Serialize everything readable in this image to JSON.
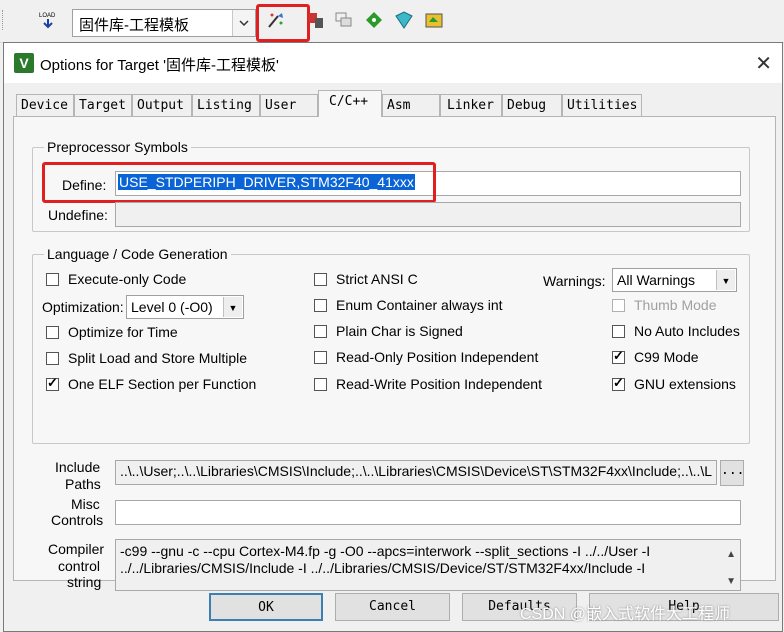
{
  "toolbar": {
    "target_name": "固件库-工程模板",
    "load_label": "LOAD",
    "icons": [
      "load-icon",
      "options-for-target-icon",
      "manage-project-icon",
      "file-extensions-icon",
      "pack-installer-icon",
      "manage-run-time-icon",
      "select-packs-icon"
    ]
  },
  "dialog": {
    "title": "Options for Target '固件库-工程模板'",
    "close": "✕",
    "tabs": [
      "Device",
      "Target",
      "Output",
      "Listing",
      "User",
      "C/C++",
      "Asm",
      "Linker",
      "Debug",
      "Utilities"
    ],
    "active_tab": "C/C++"
  },
  "preprocessor": {
    "group_title": "Preprocessor Symbols",
    "define_label": "Define:",
    "define_value": "USE_STDPERIPH_DRIVER,STM32F40_41xxx",
    "undefine_label": "Undefine:",
    "undefine_value": ""
  },
  "language": {
    "group_title": "Language / Code Generation",
    "execute_only": {
      "label": "Execute-only Code",
      "checked": false
    },
    "optimization_label": "Optimization:",
    "optimization_value": "Level 0 (-O0)",
    "optimize_time": {
      "label": "Optimize for Time",
      "checked": false
    },
    "split_load": {
      "label": "Split Load and Store Multiple",
      "checked": false
    },
    "one_elf": {
      "label": "One ELF Section per Function",
      "checked": true
    },
    "strict_ansi": {
      "label": "Strict ANSI C",
      "checked": false
    },
    "enum_container": {
      "label": "Enum Container always int",
      "checked": false
    },
    "plain_char": {
      "label": "Plain Char is Signed",
      "checked": false
    },
    "ro_pi": {
      "label": "Read-Only Position Independent",
      "checked": false
    },
    "rw_pi": {
      "label": "Read-Write Position Independent",
      "checked": false
    },
    "warnings_label": "Warnings:",
    "warnings_value": "All Warnings",
    "thumb_mode": {
      "label": "Thumb Mode",
      "checked": false
    },
    "no_auto_includes": {
      "label": "No Auto Includes",
      "checked": false
    },
    "c99_mode": {
      "label": "C99 Mode",
      "checked": true
    },
    "gnu_extensions": {
      "label": "GNU extensions",
      "checked": true
    }
  },
  "paths": {
    "include_label_1": "Include",
    "include_label_2": "Paths",
    "include_value": "..\\..\\User;..\\..\\Libraries\\CMSIS\\Include;..\\..\\Libraries\\CMSIS\\Device\\ST\\STM32F4xx\\Include;..\\..\\L",
    "browse_label": "...",
    "misc_label_1": "Misc",
    "misc_label_2": "Controls",
    "misc_value": "",
    "compiler_label_1": "Compiler",
    "compiler_label_2": "control",
    "compiler_label_3": "string",
    "compiler_line_1": "-c99 --gnu -c --cpu Cortex-M4.fp -g -O0 --apcs=interwork --split_sections -I ../../User -I",
    "compiler_line_2": "../../Libraries/CMSIS/Include -I ../../Libraries/CMSIS/Device/ST/STM32F4xx/Include -I"
  },
  "buttons": {
    "ok": "OK",
    "cancel": "Cancel",
    "defaults": "Defaults",
    "help": "Help"
  },
  "watermark": "CSDN @嵌入式软件大工程师",
  "accent": "#e02020"
}
